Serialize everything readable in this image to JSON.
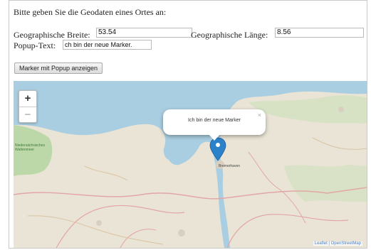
{
  "form": {
    "intro": "Bitte geben Sie die Geodaten eines Ortes an:",
    "latitude_label": "Geographische Breite:",
    "latitude_value": "53.54",
    "longitude_label": "Geographische Länge:",
    "longitude_value": "8.56",
    "popup_label": "Popup-Text:",
    "popup_value": "ch bin der neue Marker.",
    "show_button": "Marker mit Popup anzeigen"
  },
  "map": {
    "zoom_in": "+",
    "zoom_out": "−",
    "popup_text": "Ich bin der neue Marker",
    "popup_close": "×",
    "marker_label": "Bremerhaven",
    "area_label": "Niedersächsisches Wattenmeer",
    "attribution": "Leaflet | OpenStreetMap",
    "colors": {
      "water": "#a9cee1",
      "land": "#e9e4d6",
      "green": "#b8d6a3",
      "marker": "#2b82cb",
      "roads": "#e3a6a6"
    }
  }
}
